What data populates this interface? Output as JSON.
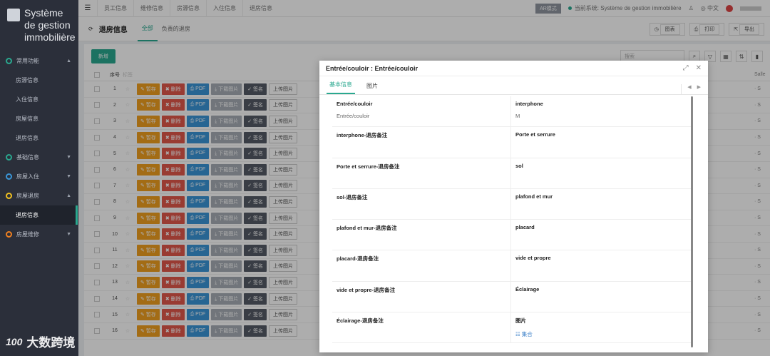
{
  "app": {
    "title": "Système de gestion immobilière"
  },
  "sidebar": {
    "items": [
      {
        "label": "常用功能",
        "color": "#2aa88f",
        "arrow": "▲"
      },
      {
        "label": "房源信息",
        "sub": true
      },
      {
        "label": "入住信息",
        "sub": true
      },
      {
        "label": "房屋信息",
        "sub": true
      },
      {
        "label": "退房信息",
        "sub": true
      },
      {
        "label": "基础信息",
        "color": "#2aa88f",
        "arrow": "▼"
      },
      {
        "label": "房屋入住",
        "color": "#3a96d8",
        "arrow": "▼"
      },
      {
        "label": "房屋退房",
        "color": "#f0c020",
        "arrow": "▲"
      },
      {
        "label": "退房信息",
        "sub": true,
        "active": true
      },
      {
        "label": "房屋维修",
        "color": "#f08020",
        "arrow": "▼"
      }
    ]
  },
  "watermark": {
    "text": "大数跨境",
    "logo": "100"
  },
  "topbar": {
    "tabs": [
      "员工信息",
      "维修信息",
      "房源信息",
      "入住信息",
      "退房信息"
    ],
    "mode_button": "AR模式",
    "current_system": "当前系统: Système de gestion immobilière",
    "lang": "中文"
  },
  "page": {
    "title": "退房信息",
    "subtabs": [
      "全部",
      "负责的退房"
    ],
    "actions": [
      "图表",
      "打印",
      "导出"
    ],
    "new_button": "新增",
    "search_placeholder": "搜索",
    "columns": [
      "序号",
      "标签"
    ],
    "right_column": "Salle",
    "actions_row": {
      "save": "暂存",
      "delete": "删除",
      "pdf": "PDF",
      "download": "下载图片",
      "sign": "签名",
      "upload": "上传图片"
    },
    "rows": [
      "1",
      "2",
      "3",
      "4",
      "5",
      "6",
      "7",
      "8",
      "9",
      "10",
      "11",
      "12",
      "13",
      "14",
      "15",
      "16"
    ]
  },
  "modal": {
    "title": "Entrée/couloir : Entrée/couloir",
    "tabs": [
      "基本信息",
      "图片"
    ],
    "fields": [
      {
        "label": "Entrée/couloir",
        "value": "Entrée/couloir"
      },
      {
        "label": "interphone",
        "value": "M"
      },
      {
        "label": "interphone-退房备注",
        "value": ""
      },
      {
        "label": "Porte et serrure",
        "value": ""
      },
      {
        "label": "Porte et serrure-退房备注",
        "value": ""
      },
      {
        "label": "sol",
        "value": ""
      },
      {
        "label": "sol-退房备注",
        "value": ""
      },
      {
        "label": "plafond et mur",
        "value": ""
      },
      {
        "label": "plafond et mur-退房备注",
        "value": ""
      },
      {
        "label": "placard",
        "value": ""
      },
      {
        "label": "placard-退房备注",
        "value": ""
      },
      {
        "label": "vide et propre",
        "value": ""
      },
      {
        "label": "vide et propre-退房备注",
        "value": ""
      },
      {
        "label": "Éclairage",
        "value": ""
      },
      {
        "label": "Éclairage-退房备注",
        "value": ""
      },
      {
        "label": "图片",
        "value": "集合",
        "link": true
      }
    ]
  }
}
